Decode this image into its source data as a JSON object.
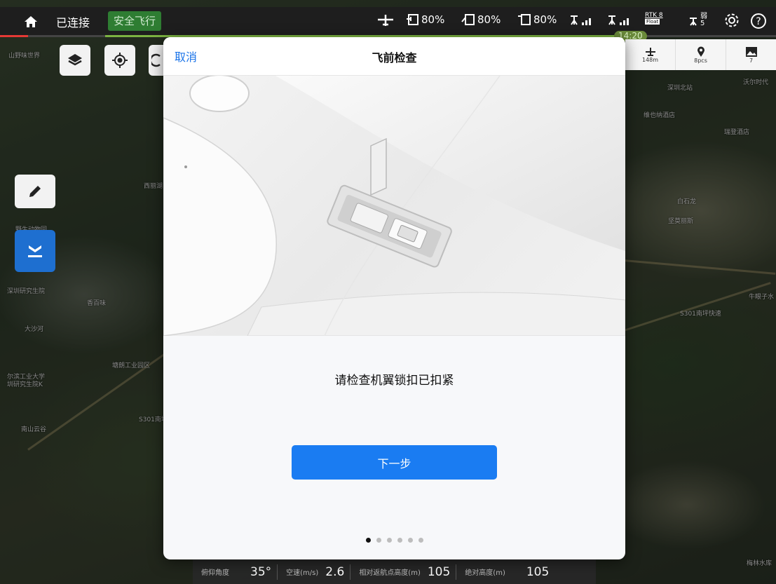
{
  "topbar": {
    "connection_status": "已连接",
    "flight_status": "安全飞行",
    "aircraft_battery": "80%",
    "rc_battery": "80%",
    "remote_battery": "80%",
    "rtk_label": "RTK",
    "rtk_count": "8",
    "rtk_sub": "Float",
    "satellite_count": "5",
    "satellite_label": "弱",
    "countdown": "14:20"
  },
  "mini_panel": {
    "distance": "148m",
    "points": "8pcs",
    "photos": "7"
  },
  "map": {
    "labels": [
      "山野味世界",
      "西丽湖",
      "野生动物园",
      "深圳研究生院",
      "香百味",
      "大沙河",
      "塘朗工业园区",
      "尔滨工业大学",
      "圳研究生院K",
      "南山云谷",
      "S301南坪快速",
      "深圳北站",
      "维也纳酒店",
      "瑞登酒店",
      "白石龙",
      "坚莫丽斯",
      "S301南坪快速",
      "牛眼子水",
      "梅林水库",
      "沃尔时代"
    ]
  },
  "modal": {
    "cancel": "取消",
    "title": "飞前检查",
    "instruction": "请检查机翼锁扣已扣紧",
    "next_button": "下一步",
    "step_count": 6,
    "active_step": 1
  },
  "telemetry": {
    "pitch_label": "俯仰角度",
    "pitch_value": "35°",
    "airspeed_label": "空速(m/s)",
    "airspeed_value": "2.6",
    "rel_alt_label": "相对返航点高度(m)",
    "rel_alt_value": "105",
    "abs_alt_label": "绝对高度(m)",
    "abs_alt_value": "105"
  },
  "colors": {
    "accent_blue": "#1a7cf2",
    "safe_green": "#2e7d32",
    "topbar_bg": "#1e1e1e"
  }
}
